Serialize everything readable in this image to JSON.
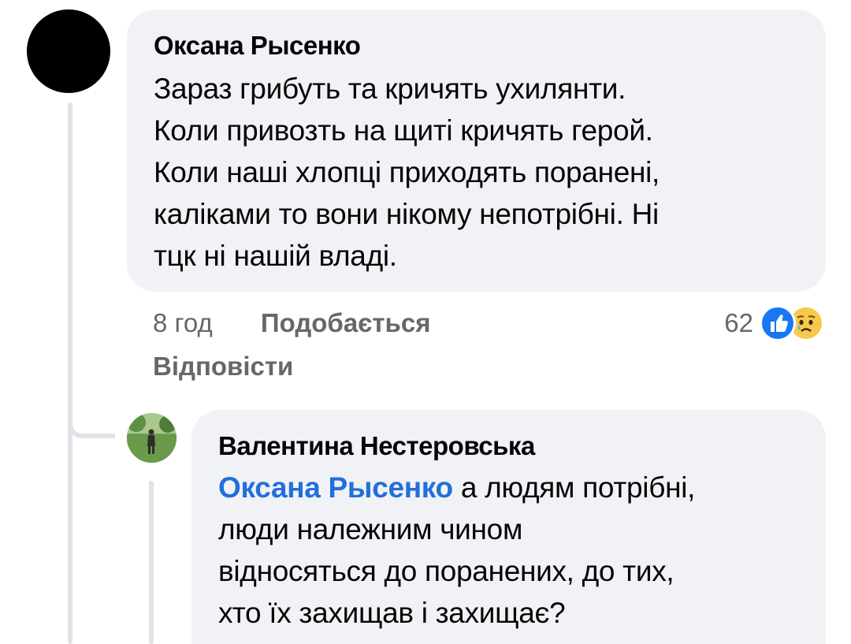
{
  "main_comment": {
    "author": "Оксана Рысенко",
    "text": "Зараз грибуть та кричять ухилянти.\nКоли привозть на щиті кричять герой.\nКоли наші хлопці приходять поранені,\nкаліками то вони нікому непотрібні. Ні\nтцк ні нашій владі.",
    "time": "8 год",
    "like_label": "Подобається",
    "reply_label": "Відповісти",
    "reaction_count": "62",
    "reaction_icons": [
      "like-icon",
      "sad-icon"
    ]
  },
  "reply_comment": {
    "author": "Валентина Нестеровська",
    "mention": "Оксана Рысенко",
    "text": " а людям потрібні,\nлюди належним чином\nвідносяться до поранених, до тих,\nхто їх захищав і захищає?"
  },
  "colors": {
    "bubble_bg": "#f0f2f5",
    "mention": "#216fdb",
    "secondary_text": "#65676b",
    "like_blue": "#1877f2",
    "sad_yellow": "#f7c94b"
  }
}
